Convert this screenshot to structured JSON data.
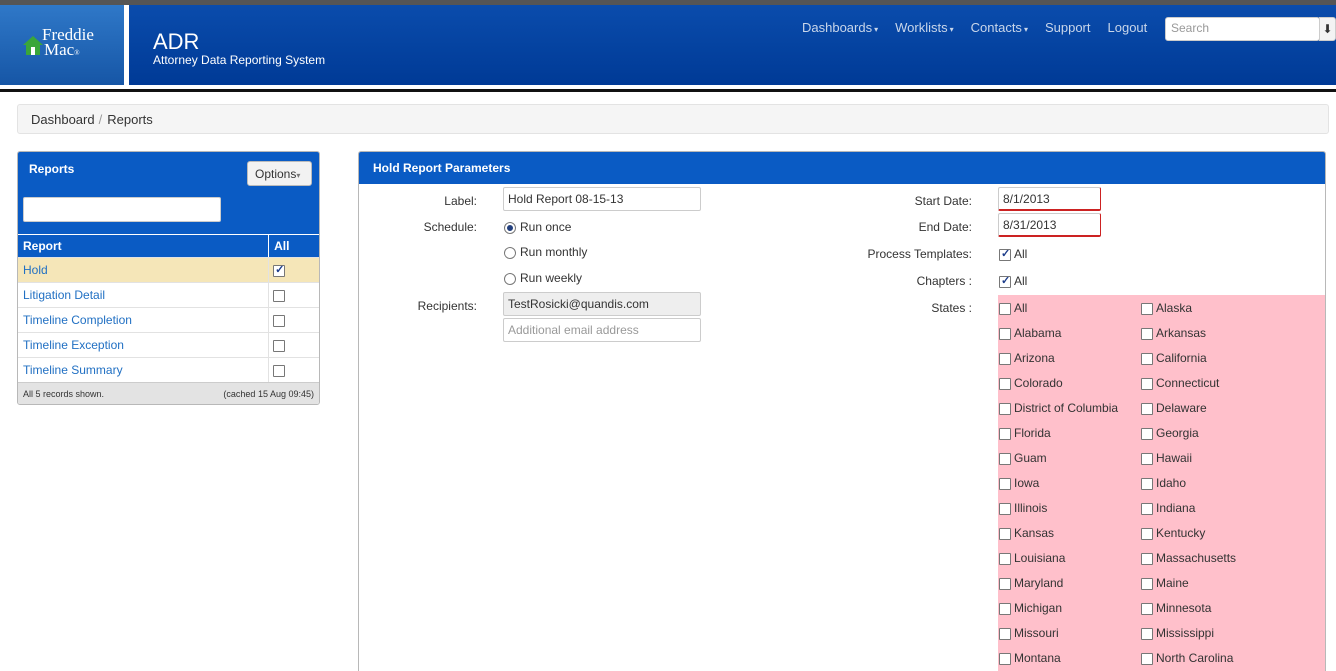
{
  "header": {
    "logo_line1": "Freddie",
    "logo_line2": "Mac",
    "app_title": "ADR",
    "app_subtitle": "Attorney Data Reporting System",
    "nav": [
      {
        "label": "Dashboards",
        "dropdown": true
      },
      {
        "label": "Worklists",
        "dropdown": true
      },
      {
        "label": "Contacts",
        "dropdown": true
      },
      {
        "label": "Support",
        "dropdown": false
      },
      {
        "label": "Logout",
        "dropdown": false
      }
    ],
    "search_placeholder": "Search",
    "search_button": "⬇"
  },
  "breadcrumb": {
    "items": [
      "Dashboard",
      "Reports"
    ],
    "separator": "/"
  },
  "reports_panel": {
    "title": "Reports",
    "options_label": "Options",
    "filter_value": "",
    "col_report": "Report",
    "col_all": "All",
    "rows": [
      {
        "label": "Hold",
        "checked": true,
        "selected": true
      },
      {
        "label": "Litigation Detail",
        "checked": false,
        "selected": false
      },
      {
        "label": "Timeline Completion",
        "checked": false,
        "selected": false
      },
      {
        "label": "Timeline Exception",
        "checked": false,
        "selected": false
      },
      {
        "label": "Timeline Summary",
        "checked": false,
        "selected": false
      }
    ],
    "footer_left": "All 5 records shown.",
    "footer_right": "(cached 15 Aug 09:45)"
  },
  "params_panel": {
    "title": "Hold Report Parameters",
    "label_label": "Label:",
    "label_value": "Hold Report 08-15-13",
    "schedule_label": "Schedule:",
    "schedule_options": [
      {
        "label": "Run once",
        "checked": true
      },
      {
        "label": "Run monthly",
        "checked": false
      },
      {
        "label": "Run weekly",
        "checked": false
      }
    ],
    "recipients_label": "Recipients:",
    "recipient_value": "TestRosicki@quandis.com",
    "additional_email_placeholder": "Additional email address",
    "start_date_label": "Start Date:",
    "start_date_value": "8/1/2013",
    "end_date_label": "End Date:",
    "end_date_value": "8/31/2013",
    "process_templates_label": "Process Templates:",
    "process_templates_all": "All",
    "chapters_label": "Chapters :",
    "chapters_all": "All",
    "states_label": "States :",
    "states_col1": [
      "All",
      "Alabama",
      "Arizona",
      "Colorado",
      "District of Columbia",
      "Florida",
      "Guam",
      "Iowa",
      "Illinois",
      "Kansas",
      "Louisiana",
      "Maryland",
      "Michigan",
      "Missouri",
      "Montana"
    ],
    "states_col2": [
      "Alaska",
      "Arkansas",
      "California",
      "Connecticut",
      "Delaware",
      "Georgia",
      "Hawaii",
      "Idaho",
      "Indiana",
      "Kentucky",
      "Massachusetts",
      "Maine",
      "Minnesota",
      "Mississippi",
      "North Carolina"
    ],
    "states_highlight_color": "#ffc0cb"
  },
  "colors": {
    "header_blue": "#003a96",
    "panel_blue": "#0a5bc4",
    "link_blue": "#2170c3",
    "selected_row": "#f5e6b8"
  }
}
